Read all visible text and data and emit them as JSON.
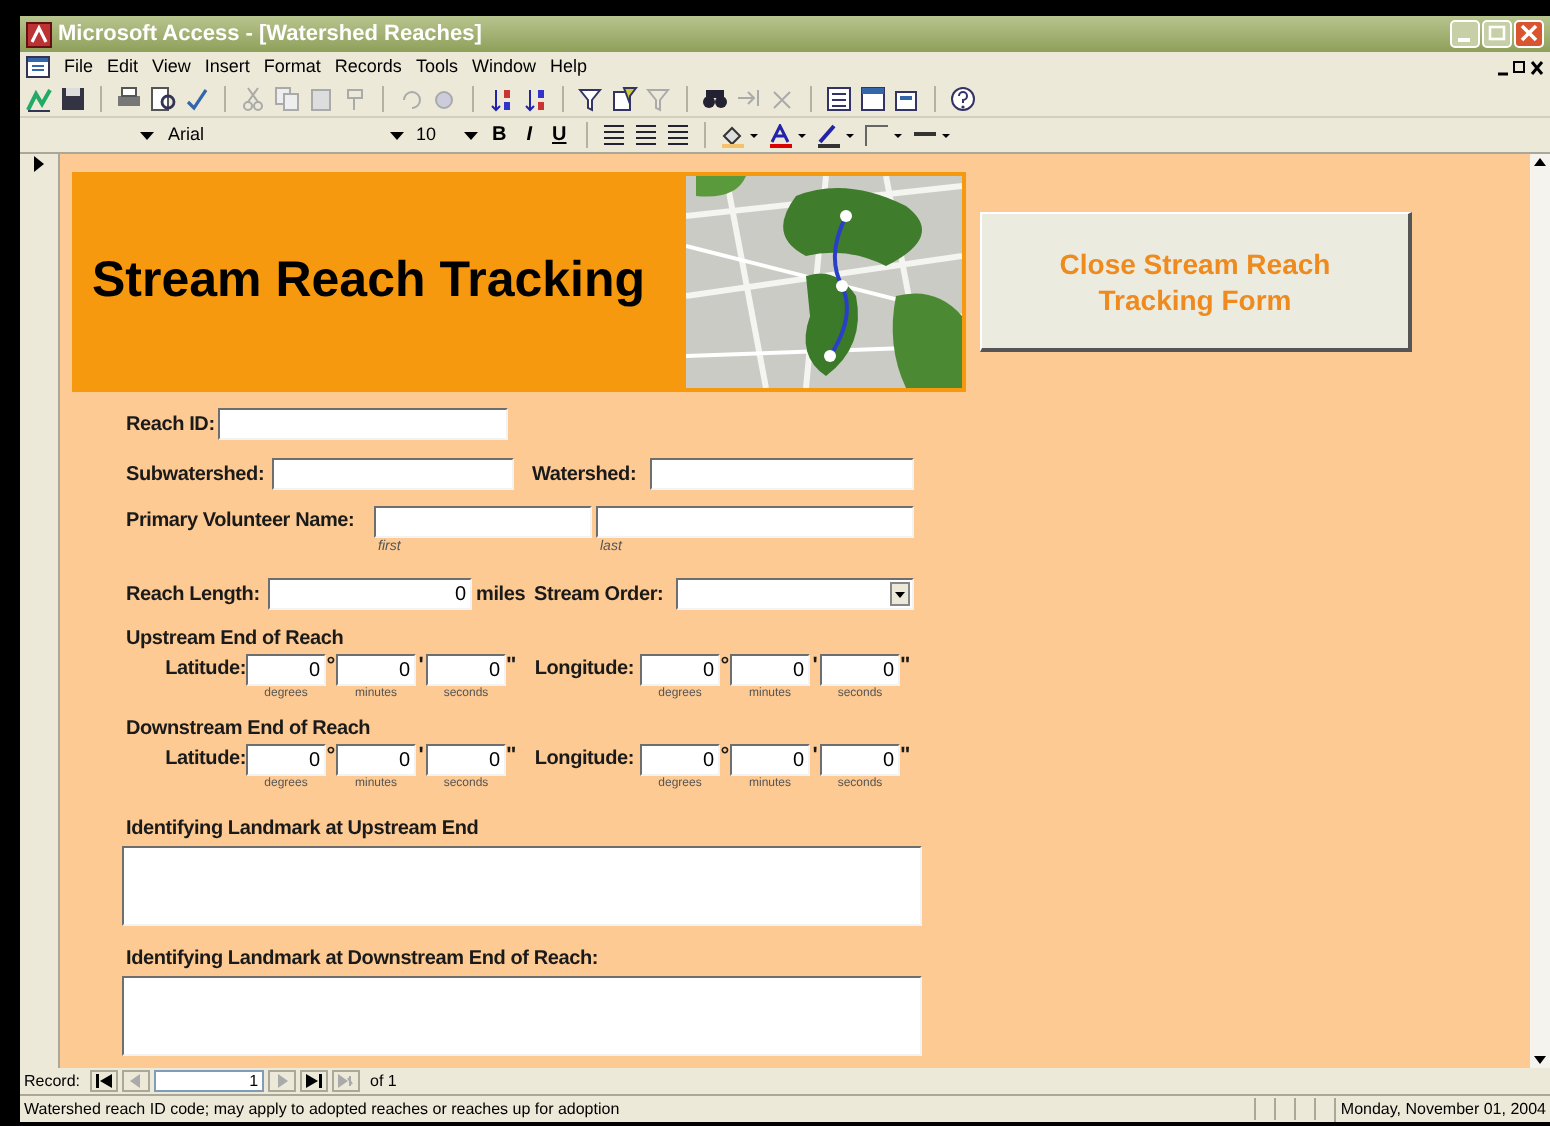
{
  "window": {
    "title": "Microsoft Access - [Watershed Reaches]"
  },
  "menu": [
    "File",
    "Edit",
    "View",
    "Insert",
    "Format",
    "Records",
    "Tools",
    "Window",
    "Help"
  ],
  "format_toolbar": {
    "font": "Arial",
    "size": "10",
    "bold": "B",
    "italic": "I",
    "underline": "U"
  },
  "form": {
    "title": "Stream Reach Tracking",
    "close_button": "Close Stream Reach Tracking Form",
    "reach_id": {
      "label": "Reach ID:"
    },
    "subwatershed": {
      "label": "Subwatershed:"
    },
    "watershed": {
      "label": "Watershed:"
    },
    "volunteer": {
      "label": "Primary Volunteer Name:",
      "captions": [
        "first",
        "last"
      ]
    },
    "reach_length": {
      "label": "Reach Length:",
      "value": "0",
      "unit": "miles"
    },
    "stream_order": {
      "label": "Stream Order:"
    },
    "coordinates": [
      {
        "heading": "Upstream End of Reach",
        "axes": [
          {
            "label": "Latitude:",
            "parts": [
              {
                "value": "0",
                "symbol": "°",
                "caption": "degrees"
              },
              {
                "value": "0",
                "symbol": "'",
                "caption": "minutes"
              },
              {
                "value": "0",
                "symbol": "\"",
                "caption": "seconds"
              }
            ]
          },
          {
            "label": "Longitude:",
            "parts": [
              {
                "value": "0",
                "symbol": "°",
                "caption": "degrees"
              },
              {
                "value": "0",
                "symbol": "'",
                "caption": "minutes"
              },
              {
                "value": "0",
                "symbol": "\"",
                "caption": "seconds"
              }
            ]
          }
        ]
      },
      {
        "heading": "Downstream End of Reach",
        "axes": [
          {
            "label": "Latitude:",
            "parts": [
              {
                "value": "0",
                "symbol": "°",
                "caption": "degrees"
              },
              {
                "value": "0",
                "symbol": "'",
                "caption": "minutes"
              },
              {
                "value": "0",
                "symbol": "\"",
                "caption": "seconds"
              }
            ]
          },
          {
            "label": "Longitude:",
            "parts": [
              {
                "value": "0",
                "symbol": "°",
                "caption": "degrees"
              },
              {
                "value": "0",
                "symbol": "'",
                "caption": "minutes"
              },
              {
                "value": "0",
                "symbol": "\"",
                "caption": "seconds"
              }
            ]
          }
        ]
      }
    ],
    "landmarks": [
      {
        "label": "Identifying Landmark at Upstream End"
      },
      {
        "label": "Identifying Landmark at Downstream End of Reach:"
      }
    ]
  },
  "record_nav": {
    "label": "Record:",
    "current": "1",
    "total": "of 1"
  },
  "status_bar": {
    "message": "Watershed reach ID code; may apply to adopted reaches or reaches up for adoption",
    "date": "Monday, November 01, 2004"
  }
}
